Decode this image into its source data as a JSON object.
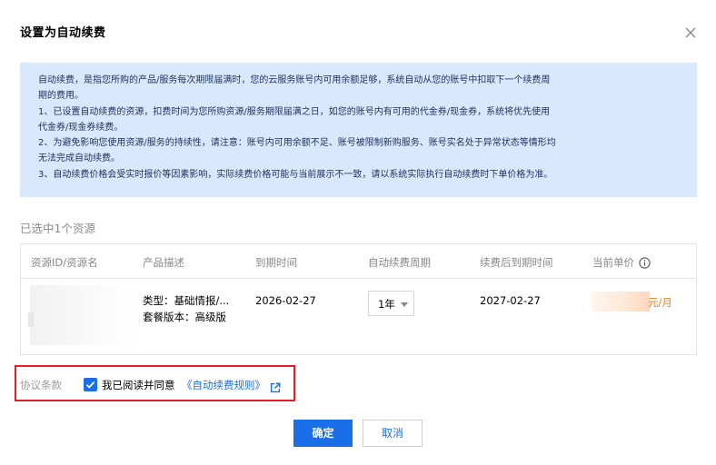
{
  "dialog": {
    "title": "设置为自动续费"
  },
  "notice": {
    "lines": [
      "自动续费，是指您所购的产品/服务每次期限届满时，您的云服务账号内可用余额足够，系统自动从您的账号中扣取下一个续费周",
      "期的费用。",
      "1、已设置自动续费的资源，扣费时间为您所购资源/服务期限届满之日，如您的账号内有可用的代金券/现金券，系统将优先使用",
      "代金券/现金券续费。",
      "2、为避免影响您使用资源/服务的持续性，请注意：账号内可用余额不足、账号被限制新购服务、账号实名处于异常状态等情形均",
      "无法完成自动续费。",
      "3、自动续费价格会受实时报价等因素影响，实际续费价格可能与当前展示不一致，请以系统实际执行自动续费时下单价格为准。"
    ]
  },
  "selection": {
    "count_text": "已选中1个资源"
  },
  "table": {
    "headers": [
      "资源ID/资源名",
      "产品描述",
      "到期时间",
      "自动续费周期",
      "续费后到期时间",
      "当前单价"
    ],
    "rows": [
      {
        "desc_type": "类型：基础情报/...",
        "desc_plan": "套餐版本：高级版",
        "expire": "2026-02-27",
        "period": "1年",
        "new_expire": "2027-02-27",
        "price_unit": "元/月"
      }
    ]
  },
  "agreement": {
    "label": "协议条款",
    "checked": true,
    "text": "我已阅读并同意",
    "link_text": "《自动续费规则》"
  },
  "buttons": {
    "confirm": "确定",
    "cancel": "取消"
  },
  "colors": {
    "primary": "#1a6fe8",
    "notice_bg": "#d9e9fd",
    "highlight_border": "#e51c23",
    "price_orange": "#f07d1a"
  },
  "icons": {
    "close": "close-icon",
    "info": "info-icon",
    "check": "check-icon",
    "external": "external-link-icon",
    "caret": "caret-down-icon"
  }
}
